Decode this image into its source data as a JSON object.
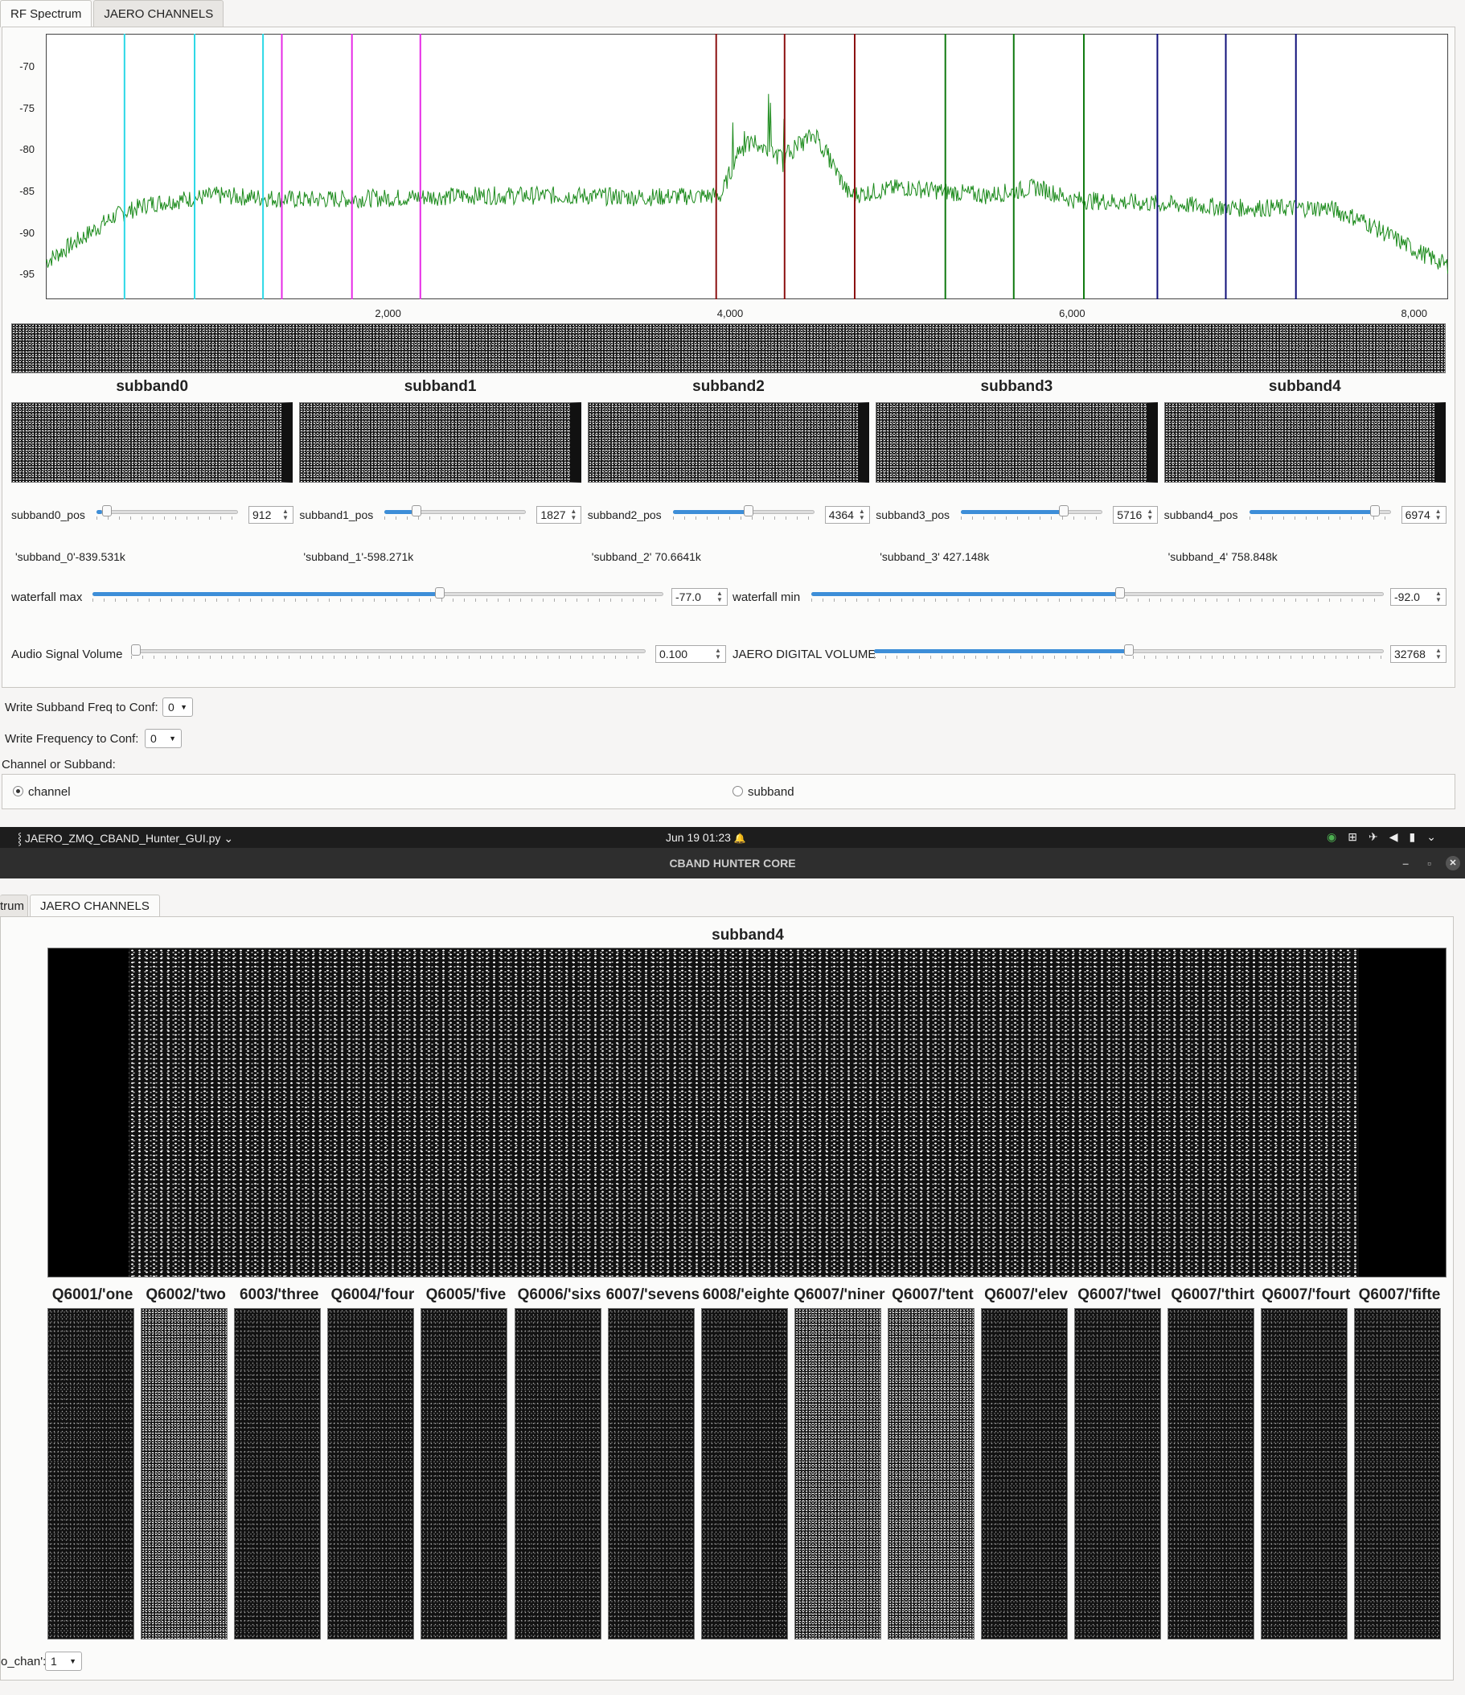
{
  "tabs_top": [
    {
      "label": "RF Spectrum"
    },
    {
      "label": "JAERO CHANNELS"
    }
  ],
  "spectrum": {
    "y_ticks": [
      "-70",
      "-75",
      "-80",
      "-85",
      "-90",
      "-95"
    ],
    "x_ticks": [
      "2,000",
      "4,000",
      "6,000",
      "8,000"
    ],
    "trace_color": "#1a8a1a"
  },
  "chart_data": {
    "type": "line",
    "x_range": [
      0,
      8200
    ],
    "ylim": [
      -98,
      -66
    ],
    "series": [
      {
        "values_sampled": [
          [
            0,
            -93.5
          ],
          [
            400,
            -88
          ],
          [
            600,
            -86.5
          ],
          [
            1000,
            -85.5
          ],
          [
            1500,
            -86
          ],
          [
            2000,
            -85.8
          ],
          [
            2500,
            -85.5
          ],
          [
            3000,
            -85.5
          ],
          [
            3500,
            -85.7
          ],
          [
            3950,
            -85.5
          ],
          [
            4050,
            -80
          ],
          [
            4150,
            -79
          ],
          [
            4300,
            -81
          ],
          [
            4500,
            -78
          ],
          [
            4700,
            -85.5
          ],
          [
            5000,
            -84.5
          ],
          [
            5500,
            -85.5
          ],
          [
            5800,
            -84.5
          ],
          [
            6000,
            -86
          ],
          [
            6500,
            -86.5
          ],
          [
            7000,
            -87
          ],
          [
            7500,
            -87
          ],
          [
            7700,
            -88.5
          ],
          [
            8000,
            -92
          ],
          [
            8200,
            -94
          ]
        ]
      }
    ],
    "markers": [
      {
        "color": "#2bd8e6",
        "x": [
          460,
          870,
          1270
        ]
      },
      {
        "color": "#e62be6",
        "x": [
          1380,
          1790,
          2190
        ]
      },
      {
        "color": "#8b1010",
        "x": [
          3920,
          4320,
          4730
        ]
      },
      {
        "color": "#0f7a0f",
        "x": [
          5260,
          5660,
          6070
        ]
      },
      {
        "color": "#10107a",
        "x": [
          6500,
          6900,
          7310
        ]
      }
    ]
  },
  "subbands": [
    {
      "title": "subband0",
      "pos_label": "subband0_pos",
      "pos_value": "912",
      "pos_fraction": 0.04,
      "freq": "'subband_0'-839.531k"
    },
    {
      "title": "subband1",
      "pos_label": "subband1_pos",
      "pos_value": "1827",
      "pos_fraction": 0.2,
      "freq": "'subband_1'-598.271k"
    },
    {
      "title": "subband2",
      "pos_label": "subband2_pos",
      "pos_value": "4364",
      "pos_fraction": 0.52,
      "freq": "'subband_2' 70.6641k"
    },
    {
      "title": "subband3",
      "pos_label": "subband3_pos",
      "pos_value": "5716",
      "pos_fraction": 0.72,
      "freq": "'subband_3' 427.148k"
    },
    {
      "title": "subband4",
      "pos_label": "subband4_pos",
      "pos_value": "6974",
      "pos_fraction": 0.88,
      "freq": "'subband_4' 758.848k"
    }
  ],
  "controls": {
    "waterfall_max_label": "waterfall max",
    "waterfall_max_value": "-77.0",
    "waterfall_max_fraction": 0.61,
    "waterfall_min_label": "waterfall min",
    "waterfall_min_value": "-92.0",
    "waterfall_min_fraction": 0.54,
    "audio_label": "Audio Signal Volume",
    "audio_value": "0.100",
    "audio_fraction": 0.0,
    "jaero_vol_label": "JAERO DIGITAL VOLUME",
    "jaero_vol_value": "32768",
    "jaero_vol_fraction": 0.5
  },
  "conf": {
    "write_subband_label": "Write Subband Freq to Conf:",
    "write_subband_value": "0",
    "write_freq_label": "Write Frequency to Conf:",
    "write_freq_value": "0",
    "chan_or_sub_label": "Channel or Subband:",
    "radio_channel": "channel",
    "radio_subband": "subband"
  },
  "topbar": {
    "app": "JAERO_ZMQ_CBAND_Hunter_GUI.py",
    "app_arrow": "⌄",
    "clock": "Jun 19  01:23",
    "bell": "🔔"
  },
  "window": {
    "title": "CBAND HUNTER CORE",
    "minimize": "–",
    "maximize": "▫",
    "close": "✕"
  },
  "tabs_bottom": [
    {
      "label": "trum"
    },
    {
      "label": "JAERO CHANNELS"
    }
  ],
  "channels_view": {
    "subband_title": "subband4",
    "channels": [
      "Q6001/'one",
      "Q6002/'two",
      "6003/'three",
      "Q6004/'four",
      "Q6005/'five",
      "Q6006/'sixs",
      "6007/'sevens",
      "6008/'eighte",
      "Q6007/'niner",
      "Q6007/'tent",
      "Q6007/'elev",
      "Q6007/'twel",
      "Q6007/'thirt",
      "Q6007/'fourt",
      "Q6007/'fifte"
    ],
    "chan_label": "o_chan':",
    "chan_value": "1"
  }
}
